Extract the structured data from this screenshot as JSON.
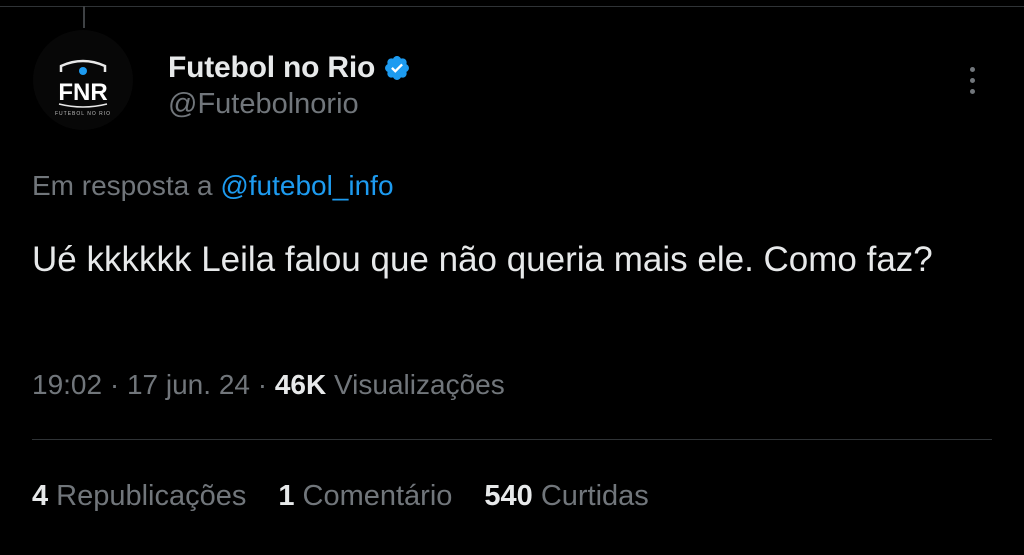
{
  "tweet": {
    "author": {
      "display_name": "Futebol no Rio",
      "handle": "@Futebolnorio",
      "verified": true,
      "avatar_text": "FNR",
      "avatar_subtext": "FUTEBOL NO RIO"
    },
    "reply_prefix": "Em resposta a",
    "reply_mention": "@futebol_info",
    "text": "Ué kkkkkk Leila falou que não queria mais ele. Como faz?",
    "time": "19:02",
    "date": "17 jun. 24",
    "views_count": "46K",
    "views_label": "Visualizações",
    "stats": {
      "reposts_count": "4",
      "reposts_label": "Republicações",
      "comments_count": "1",
      "comments_label": "Comentário",
      "likes_count": "540",
      "likes_label": "Curtidas"
    }
  },
  "colors": {
    "background": "#000000",
    "primary_text": "#e7e9ea",
    "secondary_text": "#71767b",
    "accent": "#1d9bf0",
    "divider": "#2f3336"
  }
}
